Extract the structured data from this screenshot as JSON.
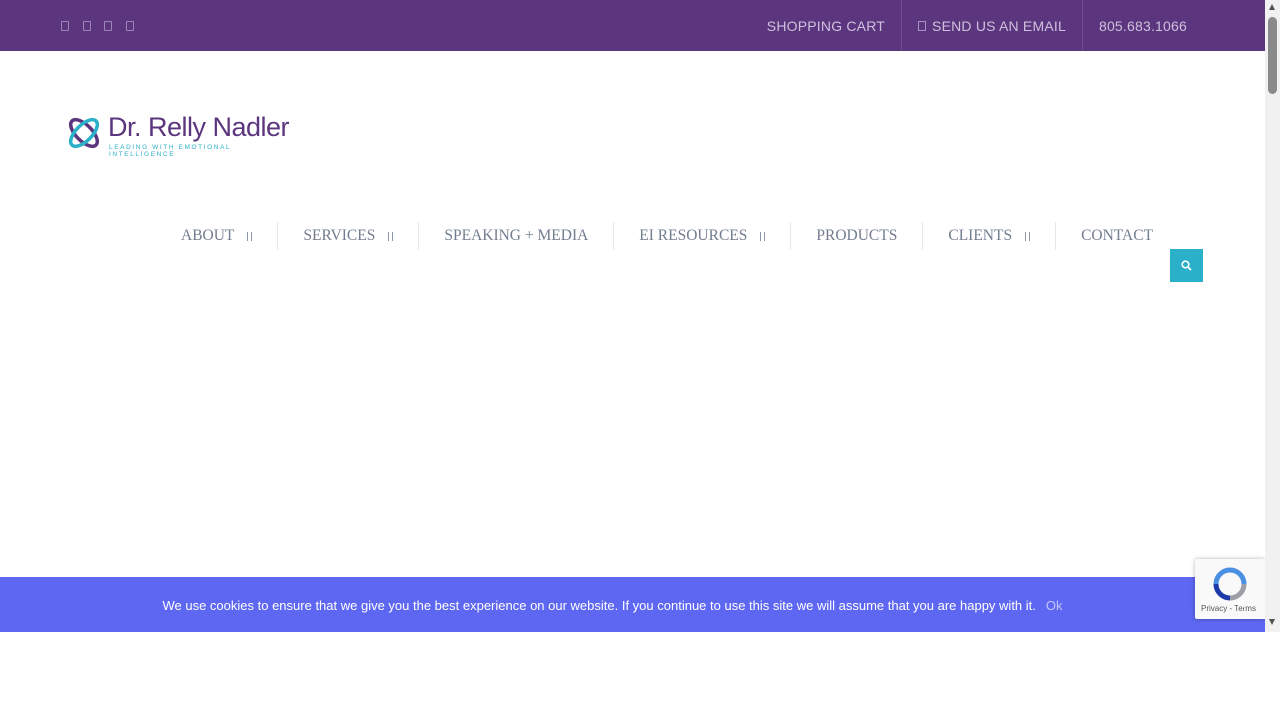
{
  "topbar": {
    "social_icons": [
      "facebook-icon",
      "twitter-icon",
      "linkedin-icon",
      "youtube-icon"
    ],
    "links": [
      {
        "label": "SHOPPING CART"
      },
      {
        "label": "SEND US AN EMAIL",
        "icon": "envelope-icon"
      },
      {
        "label": "805.683.1066"
      }
    ]
  },
  "logo": {
    "name": "Dr. Relly Nadler",
    "tagline": "LEADING WITH EMOTIONAL INTELLIGENCE"
  },
  "nav": {
    "items": [
      {
        "label": "ABOUT",
        "has_submenu": true
      },
      {
        "label": "SERVICES",
        "has_submenu": true
      },
      {
        "label": "SPEAKING + MEDIA",
        "has_submenu": false
      },
      {
        "label": "EI RESOURCES",
        "has_submenu": true
      },
      {
        "label": "PRODUCTS",
        "has_submenu": false
      },
      {
        "label": "CLIENTS",
        "has_submenu": true
      },
      {
        "label": "CONTACT",
        "has_submenu": false
      }
    ],
    "search_icon": "search-icon"
  },
  "cookie_banner": {
    "text": "We use cookies to ensure that we give you the best experience on our website. If you continue to use this site we will assume that you are happy with it.",
    "ok_label": "Ok",
    "close_glyph": "×"
  },
  "recaptcha": {
    "legal": "Privacy - Terms"
  },
  "colors": {
    "topbar": "#5b357e",
    "accent": "#2ab1c9",
    "cookie_banner": "#5e67f1",
    "nav_text": "#727d8f"
  }
}
